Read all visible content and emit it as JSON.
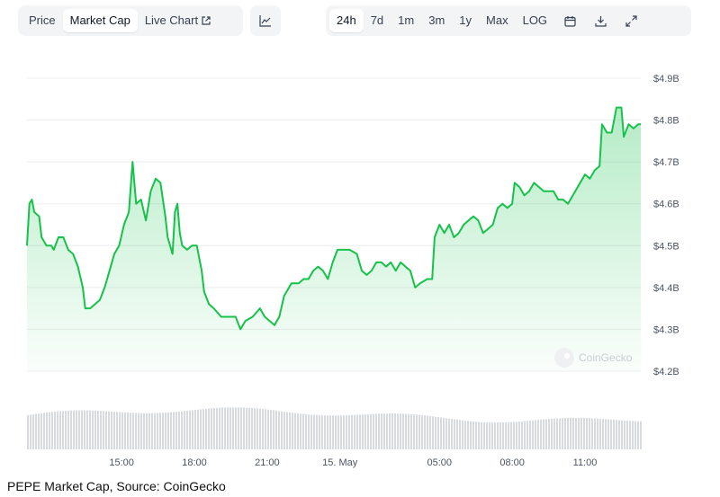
{
  "toolbar": {
    "metric_tabs": [
      "Price",
      "Market Cap",
      "Live Chart"
    ],
    "active_metric": "Market Cap",
    "range_tabs": [
      "24h",
      "7d",
      "1m",
      "3m",
      "1y",
      "Max",
      "LOG"
    ],
    "active_range": "24h",
    "icons": [
      "line-chart-icon",
      "calendar-icon",
      "download-icon",
      "expand-icon",
      "external-link-icon"
    ]
  },
  "colors": {
    "line": "#16c24a",
    "fill": "#16c24a",
    "volume": "#d7dbe0",
    "grid": "#eceef1",
    "toolbar_bg": "#f2f4f6"
  },
  "watermark": "CoinGecko",
  "caption": "PEPE Market Cap, Source: CoinGecko",
  "chart_data": {
    "type": "area",
    "x_unit": "hours",
    "x_range": [
      12.0,
      11.0
    ],
    "ylim": [
      4.2,
      4.9
    ],
    "y_ticks": [
      "$4.9B",
      "$4.8B",
      "$4.7B",
      "$4.6B",
      "$4.5B",
      "$4.4B",
      "$4.3B",
      "$4.2B"
    ],
    "y_tick_values": [
      4.9,
      4.8,
      4.7,
      4.6,
      4.5,
      4.4,
      4.3,
      4.2
    ],
    "x_ticks": [
      "15:00",
      "18:00",
      "21:00",
      "15. May",
      "05:00",
      "08:00",
      "11:00"
    ],
    "x_tick_values": [
      3.9,
      6.9,
      9.9,
      12.9,
      17.0,
      20.0,
      23.0
    ],
    "grid": true,
    "series": [
      {
        "values": [
          [
            0.0,
            4.5
          ],
          [
            0.1,
            4.6
          ],
          [
            0.2,
            4.61
          ],
          [
            0.3,
            4.58
          ],
          [
            0.5,
            4.57
          ],
          [
            0.6,
            4.52
          ],
          [
            0.8,
            4.5
          ],
          [
            1.0,
            4.5
          ],
          [
            1.1,
            4.49
          ],
          [
            1.3,
            4.52
          ],
          [
            1.5,
            4.52
          ],
          [
            1.7,
            4.49
          ],
          [
            1.9,
            4.48
          ],
          [
            2.1,
            4.45
          ],
          [
            2.3,
            4.4
          ],
          [
            2.4,
            4.35
          ],
          [
            2.6,
            4.35
          ],
          [
            2.8,
            4.36
          ],
          [
            3.0,
            4.37
          ],
          [
            3.2,
            4.4
          ],
          [
            3.4,
            4.44
          ],
          [
            3.6,
            4.48
          ],
          [
            3.8,
            4.5
          ],
          [
            4.0,
            4.55
          ],
          [
            4.2,
            4.58
          ],
          [
            4.35,
            4.7
          ],
          [
            4.5,
            4.6
          ],
          [
            4.7,
            4.61
          ],
          [
            4.9,
            4.56
          ],
          [
            5.1,
            4.63
          ],
          [
            5.3,
            4.66
          ],
          [
            5.5,
            4.65
          ],
          [
            5.7,
            4.57
          ],
          [
            5.8,
            4.52
          ],
          [
            6.0,
            4.48
          ],
          [
            6.1,
            4.58
          ],
          [
            6.2,
            4.6
          ],
          [
            6.3,
            4.53
          ],
          [
            6.4,
            4.5
          ],
          [
            6.6,
            4.49
          ],
          [
            6.8,
            4.5
          ],
          [
            7.0,
            4.5
          ],
          [
            7.2,
            4.44
          ],
          [
            7.3,
            4.39
          ],
          [
            7.5,
            4.36
          ],
          [
            7.7,
            4.35
          ],
          [
            8.0,
            4.33
          ],
          [
            8.3,
            4.33
          ],
          [
            8.6,
            4.33
          ],
          [
            8.8,
            4.3
          ],
          [
            9.0,
            4.32
          ],
          [
            9.3,
            4.33
          ],
          [
            9.6,
            4.35
          ],
          [
            9.8,
            4.33
          ],
          [
            10.0,
            4.32
          ],
          [
            10.2,
            4.31
          ],
          [
            10.4,
            4.33
          ],
          [
            10.6,
            4.38
          ],
          [
            10.9,
            4.41
          ],
          [
            11.2,
            4.41
          ],
          [
            11.4,
            4.42
          ],
          [
            11.6,
            4.42
          ],
          [
            11.8,
            4.44
          ],
          [
            12.0,
            4.45
          ],
          [
            12.2,
            4.44
          ],
          [
            12.4,
            4.42
          ],
          [
            12.6,
            4.46
          ],
          [
            12.8,
            4.49
          ],
          [
            13.0,
            4.49
          ],
          [
            13.3,
            4.49
          ],
          [
            13.6,
            4.48
          ],
          [
            13.8,
            4.44
          ],
          [
            14.0,
            4.43
          ],
          [
            14.2,
            4.44
          ],
          [
            14.4,
            4.46
          ],
          [
            14.6,
            4.46
          ],
          [
            14.8,
            4.45
          ],
          [
            15.0,
            4.46
          ],
          [
            15.2,
            4.44
          ],
          [
            15.4,
            4.46
          ],
          [
            15.6,
            4.45
          ],
          [
            15.8,
            4.44
          ],
          [
            16.0,
            4.4
          ],
          [
            16.2,
            4.41
          ],
          [
            16.5,
            4.42
          ],
          [
            16.7,
            4.42
          ],
          [
            16.8,
            4.52
          ],
          [
            17.0,
            4.55
          ],
          [
            17.2,
            4.53
          ],
          [
            17.4,
            4.55
          ],
          [
            17.6,
            4.52
          ],
          [
            17.8,
            4.53
          ],
          [
            18.0,
            4.55
          ],
          [
            18.2,
            4.56
          ],
          [
            18.4,
            4.57
          ],
          [
            18.6,
            4.56
          ],
          [
            18.8,
            4.53
          ],
          [
            19.0,
            4.54
          ],
          [
            19.2,
            4.55
          ],
          [
            19.4,
            4.59
          ],
          [
            19.6,
            4.6
          ],
          [
            19.8,
            4.59
          ],
          [
            20.0,
            4.6
          ],
          [
            20.1,
            4.65
          ],
          [
            20.3,
            4.64
          ],
          [
            20.5,
            4.62
          ],
          [
            20.7,
            4.63
          ],
          [
            20.9,
            4.65
          ],
          [
            21.1,
            4.64
          ],
          [
            21.3,
            4.63
          ],
          [
            21.5,
            4.63
          ],
          [
            21.7,
            4.63
          ],
          [
            21.9,
            4.61
          ],
          [
            22.1,
            4.61
          ],
          [
            22.3,
            4.6
          ],
          [
            22.5,
            4.62
          ],
          [
            22.6,
            4.63
          ],
          [
            22.8,
            4.65
          ],
          [
            23.0,
            4.67
          ],
          [
            23.2,
            4.66
          ],
          [
            23.4,
            4.68
          ],
          [
            23.6,
            4.69
          ],
          [
            23.7,
            4.79
          ],
          [
            23.9,
            4.77
          ],
          [
            24.1,
            4.77
          ],
          [
            24.3,
            4.83
          ],
          [
            24.5,
            4.83
          ],
          [
            24.6,
            4.76
          ],
          [
            24.8,
            4.79
          ],
          [
            25.0,
            4.78
          ],
          [
            25.2,
            4.79
          ],
          [
            25.3,
            4.79
          ]
        ]
      }
    ]
  }
}
